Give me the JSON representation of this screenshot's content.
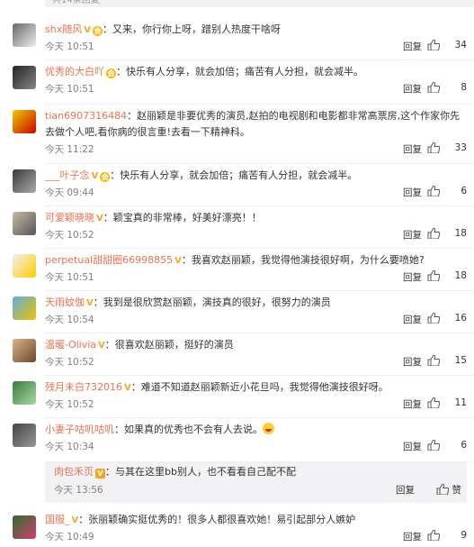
{
  "top_partial": "共14条回复",
  "comments": [
    {
      "user": "shx随风",
      "text": "：又来，你行你上呀，蹭别人热度干啥呀",
      "time": "今天 10:51",
      "reply": "回复",
      "likes": "34",
      "colors": [
        "#666",
        "#eee"
      ]
    },
    {
      "user": "优秀的大白吖",
      "text": "：快乐有人分享，就会加倍；痛苦有人分担，就会减半。",
      "time": "今天 10:51",
      "reply": "回复",
      "likes": "8",
      "colors": [
        "#222",
        "#888"
      ]
    },
    {
      "user": "tian6907316484",
      "text": "：赵丽颖是非要优秀的演员,赵拍的电视剧和电影都非常高票房,这个作家你先去做个人吧,看你病的很言重!去看一下精神科。",
      "time": "今天 11:22",
      "reply": "回复",
      "likes": "33",
      "colors": [
        "#e8d000",
        "#c00"
      ]
    },
    {
      "user": "___叶子念",
      "text": "：快乐有人分享，就会加倍；痛苦有人分担，就会减半。",
      "time": "今天 09:44",
      "reply": "回复",
      "likes": "6",
      "colors": [
        "#3a3a3a",
        "#aaa"
      ]
    },
    {
      "user": "可爱颖晓晓",
      "text": "：颖宝真的非常棒，好美好漂亮！！",
      "time": "今天 10:52",
      "reply": "回复",
      "likes": "18",
      "colors": [
        "#c9b9a3",
        "#555"
      ]
    },
    {
      "user": "perpetual甜甜圈66998855",
      "text": "：我喜欢赵丽颖，我觉得他演技很好啊，为什么要喷她?",
      "time": "今天 10:51",
      "reply": "回复",
      "likes": "18",
      "colors": [
        "#f0f0f0",
        "#ffcc00"
      ]
    },
    {
      "user": "天雨蚊伽",
      "text": "：我到是很欣赏赵丽颖，演技真的很好，很努力的演员",
      "time": "今天 10:54",
      "reply": "回复",
      "likes": "16",
      "colors": [
        "#5ab0e0",
        "#f0c000"
      ]
    },
    {
      "user": "温暖-Olivia",
      "text": "：很喜欢赵丽颖，挺好的演员",
      "time": "今天 10:52",
      "reply": "回复",
      "likes": "15",
      "colors": [
        "#d9b38c",
        "#6b4a2b"
      ]
    },
    {
      "user": "残月未白732016",
      "text": "：难道不知道赵丽颖新近小花旦吗，我觉得他演技很好呀。",
      "time": "今天 10:52",
      "reply": "回复",
      "likes": "11",
      "colors": [
        "#3b7a3b",
        "#a8d8a8"
      ]
    },
    {
      "user": "小妻子咕叽咕叽",
      "text": "：如果真的优秀也不会有人去说。",
      "time": "今天 10:34",
      "reply": "回复",
      "likes": "6",
      "colors": [
        "#444",
        "#999"
      ]
    }
  ],
  "sub_reply": {
    "user": "肉包禾页",
    "text": "：与其在这里bb别人，也不看看自己配不配",
    "time": "今天 13:56",
    "reply": "回复",
    "likes": "赞"
  },
  "last": {
    "user": "国服_",
    "text": "：张丽颖确实挺优秀的！很多人都很喜欢她！易引起部分人嫉妒",
    "time": "今天 10:49",
    "reply": "回复",
    "likes": "9",
    "colors": [
      "#2e6b2e",
      "#d04070"
    ]
  }
}
